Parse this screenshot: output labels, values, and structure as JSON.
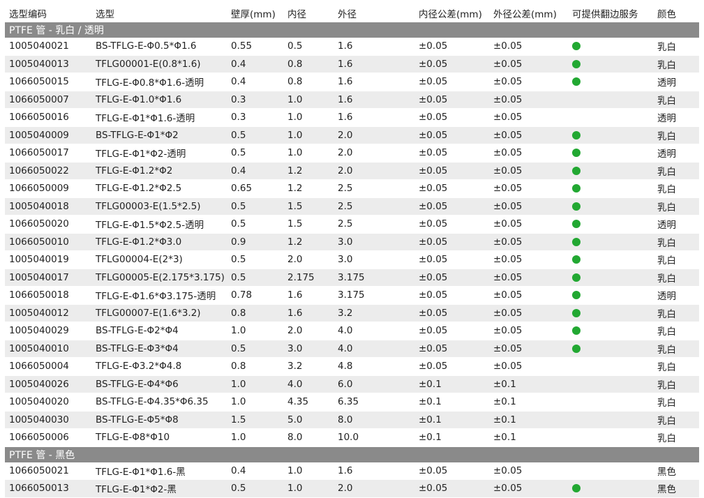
{
  "colors": {
    "group_bg": "#8a8a8a",
    "row_alt": "#ececec",
    "dot": "#22a832"
  },
  "headers": [
    "选型编码",
    "选型",
    "壁厚(mm)",
    "内径",
    "外径",
    "内径公差(mm)",
    "外径公差(mm)",
    "可提供翻边服务",
    "颜色"
  ],
  "groups": [
    {
      "title": "PTFE 管 - 乳白 / 透明",
      "rows": [
        [
          "1005040021",
          "BS-TFLG-E-Φ0.5*Φ1.6",
          "0.55",
          "0.5",
          "1.6",
          "±0.05",
          "±0.05",
          true,
          "乳白"
        ],
        [
          "1005040013",
          "TFLG00001-E(0.8*1.6)",
          "0.4",
          "0.8",
          "1.6",
          "±0.05",
          "±0.05",
          true,
          "乳白"
        ],
        [
          "1066050015",
          "TFLG-E-Φ0.8*Φ1.6-透明",
          "0.4",
          "0.8",
          "1.6",
          "±0.05",
          "±0.05",
          true,
          "透明"
        ],
        [
          "1066050007",
          "TFLG-E-Φ1.0*Φ1.6",
          "0.3",
          "1.0",
          "1.6",
          "±0.05",
          "±0.05",
          false,
          "乳白"
        ],
        [
          "1066050016",
          "TFLG-E-Φ1*Φ1.6-透明",
          "0.3",
          "1.0",
          "1.6",
          "±0.05",
          "±0.05",
          false,
          "透明"
        ],
        [
          "1005040009",
          "BS-TFLG-E-Φ1*Φ2",
          "0.5",
          "1.0",
          "2.0",
          "±0.05",
          "±0.05",
          true,
          "乳白"
        ],
        [
          "1066050017",
          "TFLG-E-Φ1*Φ2-透明",
          "0.5",
          "1.0",
          "2.0",
          "±0.05",
          "±0.05",
          true,
          "透明"
        ],
        [
          "1066050022",
          "TFLG-E-Φ1.2*Φ2",
          "0.4",
          "1.2",
          "2.0",
          "±0.05",
          "±0.05",
          true,
          "乳白"
        ],
        [
          "1066050009",
          "TFLG-E-Φ1.2*Φ2.5",
          "0.65",
          "1.2",
          "2.5",
          "±0.05",
          "±0.05",
          true,
          "乳白"
        ],
        [
          "1005040018",
          "TFLG00003-E(1.5*2.5)",
          "0.5",
          "1.5",
          "2.5",
          "±0.05",
          "±0.05",
          true,
          "乳白"
        ],
        [
          "1066050020",
          "TFLG-E-Φ1.5*Φ2.5-透明",
          "0.5",
          "1.5",
          "2.5",
          "±0.05",
          "±0.05",
          true,
          "透明"
        ],
        [
          "1066050010",
          "TFLG-E-Φ1.2*Φ3.0",
          "0.9",
          "1.2",
          "3.0",
          "±0.05",
          "±0.05",
          true,
          "乳白"
        ],
        [
          "1005040019",
          "TFLG00004-E(2*3)",
          "0.5",
          "2.0",
          "3.0",
          "±0.05",
          "±0.05",
          true,
          "乳白"
        ],
        [
          "1005040017",
          "TFLG00005-E(2.175*3.175)",
          "0.5",
          "2.175",
          "3.175",
          "±0.05",
          "±0.05",
          true,
          "乳白"
        ],
        [
          "1066050018",
          "TFLG-E-Φ1.6*Φ3.175-透明",
          "0.78",
          "1.6",
          "3.175",
          "±0.05",
          "±0.05",
          true,
          "透明"
        ],
        [
          "1005040012",
          "TFLG00007-E(1.6*3.2)",
          "0.8",
          "1.6",
          "3.2",
          "±0.05",
          "±0.05",
          true,
          "乳白"
        ],
        [
          "1005040029",
          "BS-TFLG-E-Φ2*Φ4",
          "1.0",
          "2.0",
          "4.0",
          "±0.05",
          "±0.05",
          true,
          "乳白"
        ],
        [
          "1005040010",
          "BS-TFLG-E-Φ3*Φ4",
          "0.5",
          "3.0",
          "4.0",
          "±0.05",
          "±0.05",
          true,
          "乳白"
        ],
        [
          "1066050004",
          "TFLG-E-Φ3.2*Φ4.8",
          "0.8",
          "3.2",
          "4.8",
          "±0.05",
          "±0.05",
          false,
          "乳白"
        ],
        [
          "1005040026",
          "BS-TFLG-E-Φ4*Φ6",
          "1.0",
          "4.0",
          "6.0",
          "±0.1",
          "±0.1",
          false,
          "乳白"
        ],
        [
          "1005040020",
          "BS-TFLG-E-Φ4.35*Φ6.35",
          "1.0",
          "4.35",
          "6.35",
          "±0.1",
          "±0.1",
          false,
          "乳白"
        ],
        [
          "1005040030",
          "BS-TFLG-E-Φ5*Φ8",
          "1.5",
          "5.0",
          "8.0",
          "±0.1",
          "±0.1",
          false,
          "乳白"
        ],
        [
          "1066050006",
          "TFLG-E-Φ8*Φ10",
          "1.0",
          "8.0",
          "10.0",
          "±0.1",
          "±0.1",
          false,
          "乳白"
        ]
      ]
    },
    {
      "title": "PTFE 管 - 黑色",
      "rows": [
        [
          "1066050021",
          "TFLG-E-Φ1*Φ1.6-黑",
          "0.4",
          "1.0",
          "1.6",
          "±0.05",
          "±0.05",
          false,
          "黑色"
        ],
        [
          "1066050013",
          "TFLG-E-Φ1*Φ2-黑",
          "0.5",
          "1.0",
          "2.0",
          "±0.05",
          "±0.05",
          true,
          "黑色"
        ]
      ]
    }
  ]
}
